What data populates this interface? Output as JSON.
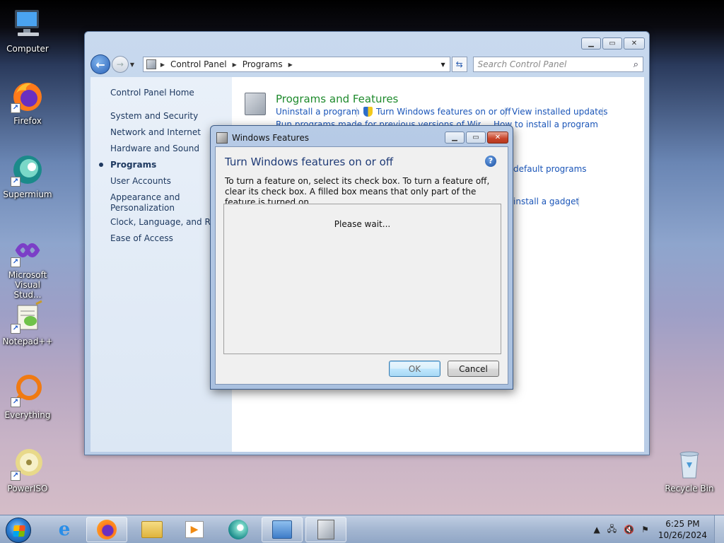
{
  "desktop": {
    "icons": [
      {
        "label": "Computer"
      },
      {
        "label": "Firefox"
      },
      {
        "label": "Supermium"
      },
      {
        "label": "Microsoft Visual Stud..."
      },
      {
        "label": "Notepad++"
      },
      {
        "label": "Everything"
      },
      {
        "label": "PowerISO"
      },
      {
        "label": "Recycle Bin"
      }
    ]
  },
  "control_panel": {
    "breadcrumb": [
      "Control Panel",
      "Programs"
    ],
    "search_placeholder": "Search Control Panel",
    "sidebar": {
      "home": "Control Panel Home",
      "items": [
        {
          "label": "System and Security"
        },
        {
          "label": "Network and Internet"
        },
        {
          "label": "Hardware and Sound"
        },
        {
          "label": "Programs"
        },
        {
          "label": "User Accounts"
        },
        {
          "label": "Appearance and Personalization"
        },
        {
          "label": "Clock, Language, and Regi"
        },
        {
          "label": "Ease of Access"
        }
      ]
    },
    "section_title": "Programs and Features",
    "links": {
      "uninstall": "Uninstall a program",
      "features": "Turn Windows features on or off",
      "updates": "View installed updates",
      "previous": "Run programs made for previous versions of Windows",
      "how_install": "How to install a program",
      "default_programs": "default programs",
      "install_gadget": "install a gadget"
    }
  },
  "dialog": {
    "title": "Windows Features",
    "heading": "Turn Windows features on or off",
    "description": "To turn a feature on, select its check box. To turn a feature off, clear its check box. A filled box means that only part of the feature is turned on.",
    "status": "Please wait...",
    "ok_label": "OK",
    "cancel_label": "Cancel"
  },
  "taskbar": {
    "time": "6:25 PM",
    "date": "10/26/2024"
  }
}
